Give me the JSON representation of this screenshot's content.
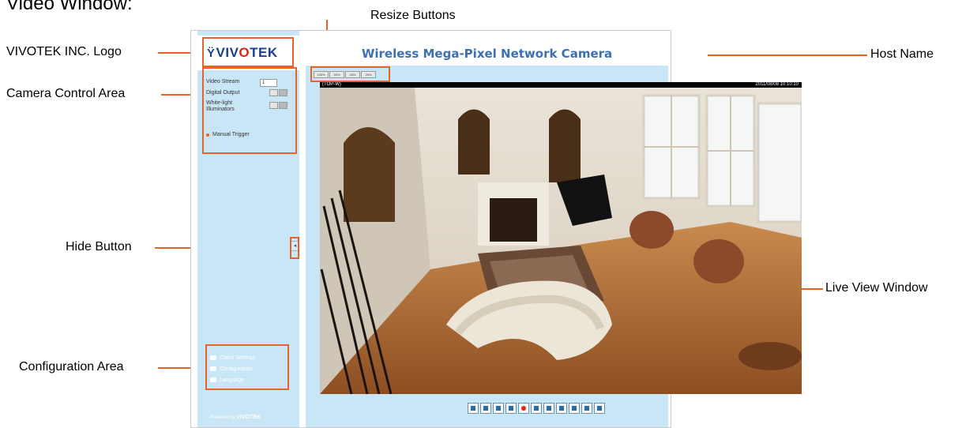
{
  "page_heading": "Video Window:",
  "callouts": {
    "resize_buttons": "Resize Buttons",
    "logo": "VIVOTEK INC. Logo",
    "camera_control": "Camera Control Area",
    "hide_button": "Hide Button",
    "configuration": "Configuration Area",
    "host_name": "Host Name",
    "live_view": "Live View Window"
  },
  "ui": {
    "logo_text_prefix": "VIV",
    "logo_text_o": "O",
    "logo_text_suffix": "TEK",
    "host_name": "Wireless Mega-Pixel Network Camera",
    "camera_control": {
      "video_stream_label": "Video Stream",
      "video_stream_value": "1",
      "digital_output_label": "Digital Output",
      "white_light_label": "White-light Illuminators",
      "manual_trigger_label": "Manual Trigger"
    },
    "hide_button_glyph": "◂",
    "config": {
      "client_settings": "Client Settings",
      "configuration": "Configuration",
      "language": "Language"
    },
    "footer_prefix": "Powered by",
    "footer_brand": "VIVOTEK",
    "resize_labels": [
      "100%",
      "50%",
      "25%",
      "25%"
    ],
    "video_overlay_left": "(TOP-W)",
    "video_overlay_right": "2011/08/08 10:10:10"
  },
  "colors": {
    "accent": "#e8632a",
    "sidebar_bg": "#c9e6f6",
    "host_name": "#3d6fb3",
    "logo": "#1b3f8f"
  }
}
